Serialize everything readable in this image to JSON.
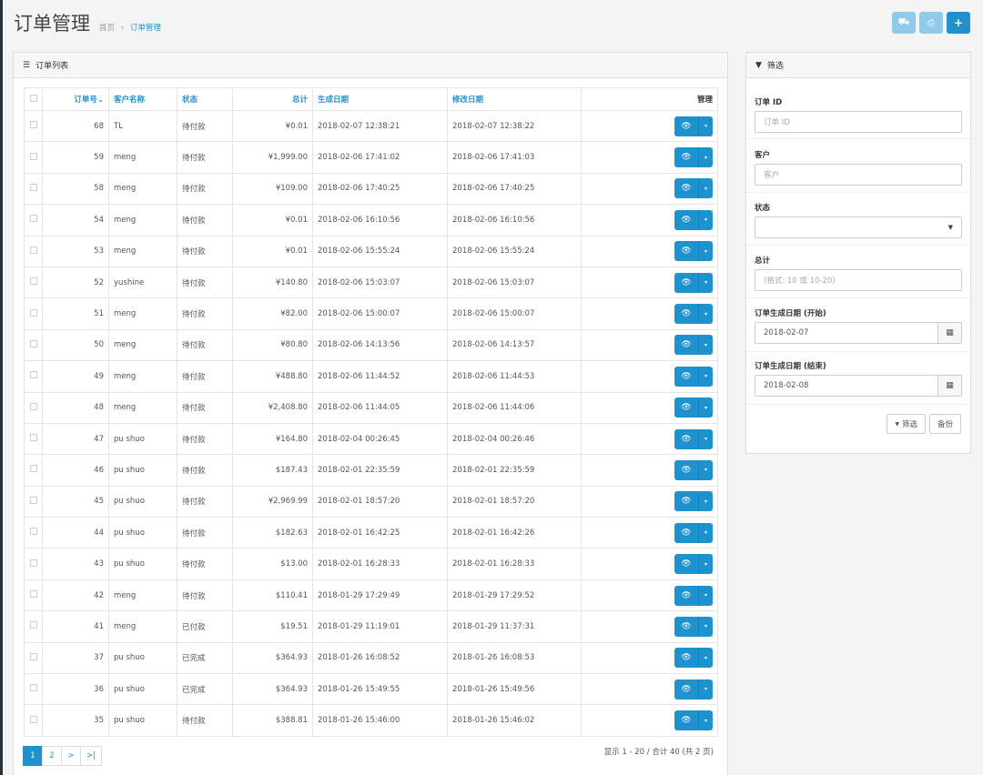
{
  "header": {
    "title": "订单管理",
    "breadcrumb_home": "首页",
    "breadcrumb_sep": "›",
    "breadcrumb_current": "订单管理"
  },
  "top_actions": [
    {
      "icon": "truck-icon",
      "glyph": "⛟"
    },
    {
      "icon": "print-icon",
      "glyph": "⎙"
    },
    {
      "icon": "plus-icon",
      "glyph": "+"
    }
  ],
  "list": {
    "title": "订单列表",
    "columns": {
      "id": "订单号",
      "sort_glyph": "⌄",
      "customer": "客户名称",
      "status": "状态",
      "total": "总计",
      "created": "生成日期",
      "modified": "修改日期",
      "manage": "管理"
    },
    "rows": [
      {
        "id": "68",
        "customer": "TL",
        "status": "待付款",
        "total": "¥0.01",
        "created": "2018-02-07 12:38:21",
        "modified": "2018-02-07 12:38:22"
      },
      {
        "id": "59",
        "customer": "meng",
        "status": "待付款",
        "total": "¥1,999.00",
        "created": "2018-02-06 17:41:02",
        "modified": "2018-02-06 17:41:03"
      },
      {
        "id": "58",
        "customer": "meng",
        "status": "待付款",
        "total": "¥109.00",
        "created": "2018-02-06 17:40:25",
        "modified": "2018-02-06 17:40:25"
      },
      {
        "id": "54",
        "customer": "meng",
        "status": "待付款",
        "total": "¥0.01",
        "created": "2018-02-06 16:10:56",
        "modified": "2018-02-06 16:10:56"
      },
      {
        "id": "53",
        "customer": "meng",
        "status": "待付款",
        "total": "¥0.01",
        "created": "2018-02-06 15:55:24",
        "modified": "2018-02-06 15:55:24"
      },
      {
        "id": "52",
        "customer": "yushine",
        "status": "待付款",
        "total": "¥140.80",
        "created": "2018-02-06 15:03:07",
        "modified": "2018-02-06 15:03:07"
      },
      {
        "id": "51",
        "customer": "meng",
        "status": "待付款",
        "total": "¥82.00",
        "created": "2018-02-06 15:00:07",
        "modified": "2018-02-06 15:00:07"
      },
      {
        "id": "50",
        "customer": "meng",
        "status": "待付款",
        "total": "¥80.80",
        "created": "2018-02-06 14:13:56",
        "modified": "2018-02-06 14:13:57"
      },
      {
        "id": "49",
        "customer": "meng",
        "status": "待付款",
        "total": "¥488.80",
        "created": "2018-02-06 11:44:52",
        "modified": "2018-02-06 11:44:53"
      },
      {
        "id": "48",
        "customer": "meng",
        "status": "待付款",
        "total": "¥2,408.80",
        "created": "2018-02-06 11:44:05",
        "modified": "2018-02-06 11:44:06"
      },
      {
        "id": "47",
        "customer": "pu shuo",
        "status": "待付款",
        "total": "¥164.80",
        "created": "2018-02-04 00:26:45",
        "modified": "2018-02-04 00:26:46"
      },
      {
        "id": "46",
        "customer": "pu shuo",
        "status": "待付款",
        "total": "$187.43",
        "created": "2018-02-01 22:35:59",
        "modified": "2018-02-01 22:35:59"
      },
      {
        "id": "45",
        "customer": "pu shuo",
        "status": "待付款",
        "total": "¥2,969.99",
        "created": "2018-02-01 18:57:20",
        "modified": "2018-02-01 18:57:20"
      },
      {
        "id": "44",
        "customer": "pu shuo",
        "status": "待付款",
        "total": "$182.63",
        "created": "2018-02-01 16:42:25",
        "modified": "2018-02-01 16:42:26"
      },
      {
        "id": "43",
        "customer": "pu shuo",
        "status": "待付款",
        "total": "$13.00",
        "created": "2018-02-01 16:28:33",
        "modified": "2018-02-01 16:28:33"
      },
      {
        "id": "42",
        "customer": "meng",
        "status": "待付款",
        "total": "$110.41",
        "created": "2018-01-29 17:29:49",
        "modified": "2018-01-29 17:29:52"
      },
      {
        "id": "41",
        "customer": "meng",
        "status": "已付款",
        "total": "$19.51",
        "created": "2018-01-29 11:19:01",
        "modified": "2018-01-29 11:37:31"
      },
      {
        "id": "37",
        "customer": "pu shuo",
        "status": "已完成",
        "total": "$364.93",
        "created": "2018-01-26 16:08:52",
        "modified": "2018-01-26 16:08:53"
      },
      {
        "id": "36",
        "customer": "pu shuo",
        "status": "已完成",
        "total": "$364.93",
        "created": "2018-01-26 15:49:55",
        "modified": "2018-01-26 15:49:56"
      },
      {
        "id": "35",
        "customer": "pu shuo",
        "status": "待付款",
        "total": "$388.81",
        "created": "2018-01-26 15:46:00",
        "modified": "2018-01-26 15:46:02"
      }
    ],
    "row_actions": {
      "view_glyph": "👁",
      "dropdown_glyph": "▾"
    },
    "pagination": [
      "1",
      "2",
      ">",
      ">|"
    ],
    "page_info": "显示 1 - 20 / 合计 40 (共 2 页)"
  },
  "filter": {
    "title": "筛选",
    "order_id": {
      "label": "订单 ID",
      "placeholder": "订单 ID"
    },
    "customer": {
      "label": "客户",
      "placeholder": "客户"
    },
    "status": {
      "label": "状态",
      "value": ""
    },
    "total": {
      "label": "总计",
      "placeholder": "(格式: 10 或 10-20)"
    },
    "date_start": {
      "label": "订单生成日期 (开始)",
      "value": "2018-02-07"
    },
    "date_end": {
      "label": "订单生成日期 (结束)",
      "value": "2018-02-08"
    },
    "filter_button": "筛选",
    "backup_button": "备份"
  },
  "colors": {
    "accent": "#1e91cf",
    "accent_light": "#8fcae9"
  }
}
